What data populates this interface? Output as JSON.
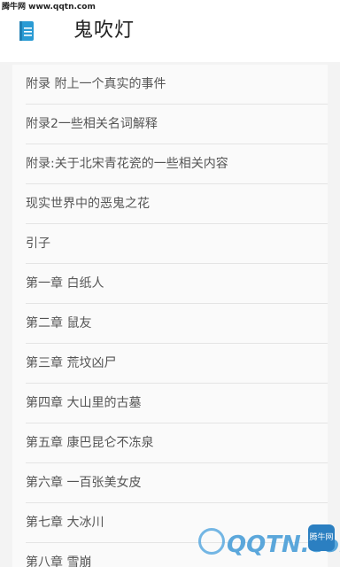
{
  "watermark": {
    "top_text": "腾牛网 www.qqtn.com",
    "logo_text": "QQTN.com",
    "badge_text": "腾牛网"
  },
  "header": {
    "title": "鬼吹灯",
    "icon": "book-icon",
    "icon_color": "#2a9bd4"
  },
  "chapters": [
    "附录 附上一个真实的事件",
    "附录2一些相关名词解释",
    "附录:关于北宋青花瓷的一些相关内容",
    "现实世界中的恶鬼之花",
    "引子",
    "第一章 白纸人",
    "第二章 鼠友",
    "第三章 荒坟凶尸",
    "第四章 大山里的古墓",
    "第五章 康巴昆仑不冻泉",
    "第六章 一百张美女皮",
    "第七章 大冰川",
    "第八章 雪崩"
  ]
}
